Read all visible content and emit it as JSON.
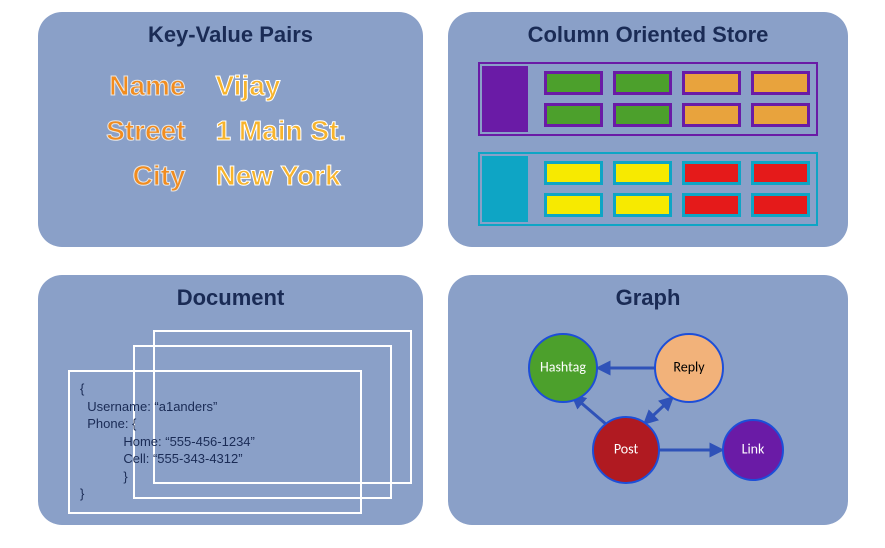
{
  "panels": {
    "kv": {
      "title": "Key-Value Pairs",
      "rows": [
        {
          "key": "Name",
          "value": "Vijay"
        },
        {
          "key": "Street",
          "value": "1 Main St."
        },
        {
          "key": "City",
          "value": "New York"
        }
      ]
    },
    "col": {
      "title": "Column Oriented Store"
    },
    "doc": {
      "title": "Document",
      "json_text": "{\n  Username: “a1anders”\n  Phone: {\n            Home: “555-456-1234”\n            Cell: “555-343-4312”\n            }\n}"
    },
    "graph": {
      "title": "Graph",
      "nodes": {
        "hashtag": "Hashtag",
        "reply": "Reply",
        "post": "Post",
        "link": "Link"
      }
    }
  }
}
